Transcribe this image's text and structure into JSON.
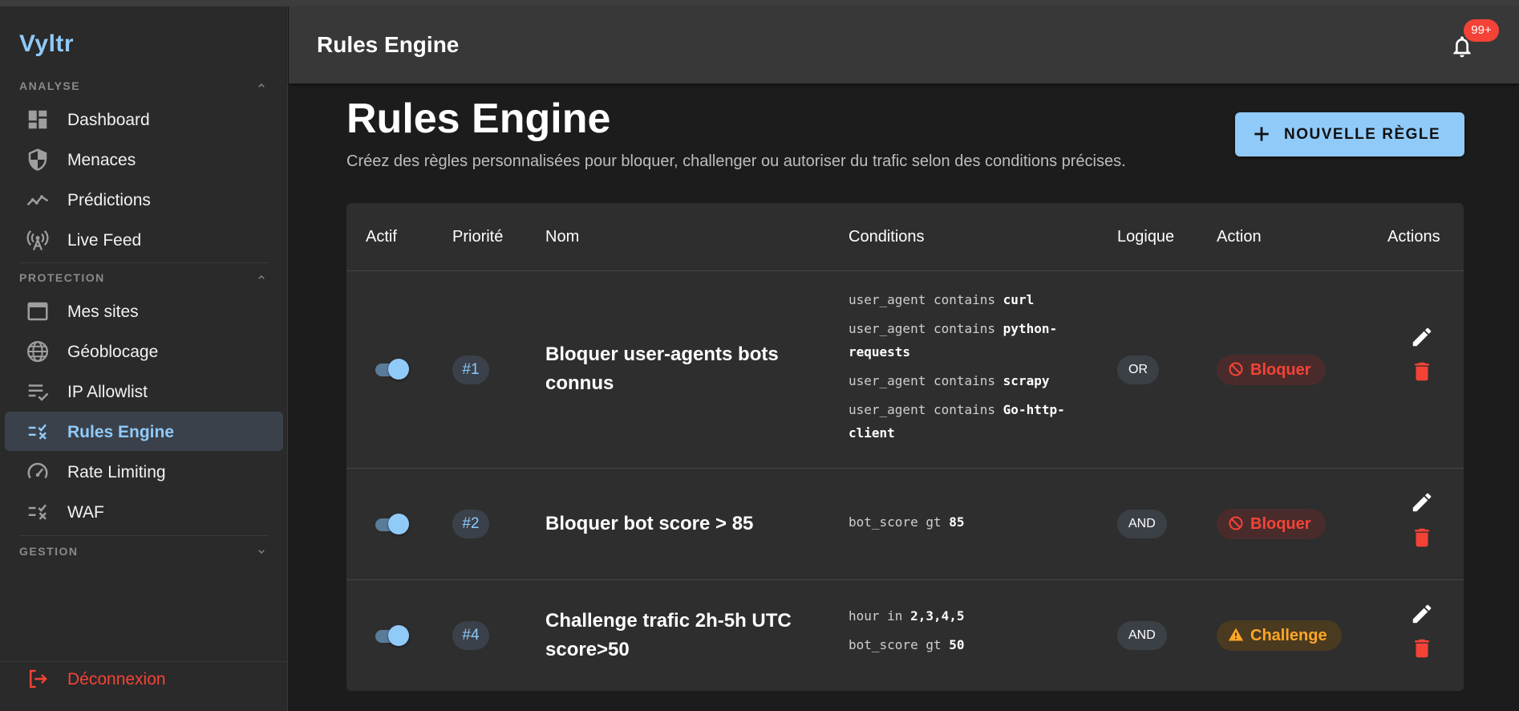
{
  "app": {
    "brand": "Vyltr"
  },
  "sidebar": {
    "sections": [
      {
        "title": "ANALYSE",
        "items": [
          {
            "label": "Dashboard",
            "icon": "dashboard-icon"
          },
          {
            "label": "Menaces",
            "icon": "shield-icon"
          },
          {
            "label": "Prédictions",
            "icon": "trend-icon"
          },
          {
            "label": "Live Feed",
            "icon": "broadcast-icon"
          }
        ]
      },
      {
        "title": "PROTECTION",
        "items": [
          {
            "label": "Mes sites",
            "icon": "window-icon"
          },
          {
            "label": "Géoblocage",
            "icon": "globe-icon"
          },
          {
            "label": "IP Allowlist",
            "icon": "checklist-icon"
          },
          {
            "label": "Rules Engine",
            "icon": "rules-icon",
            "active": true
          },
          {
            "label": "Rate Limiting",
            "icon": "speedometer-icon"
          },
          {
            "label": "WAF",
            "icon": "rules-icon"
          }
        ]
      },
      {
        "title": "GESTION",
        "items": []
      }
    ],
    "logout_label": "Déconnexion"
  },
  "header": {
    "title": "Rules Engine",
    "notifications": "99+"
  },
  "main": {
    "title": "Rules Engine",
    "subtitle": "Créez des règles personnalisées pour bloquer, challenger ou autoriser du trafic selon des conditions précises.",
    "new_button": "NOUVELLE RÈGLE"
  },
  "table": {
    "columns": [
      "Actif",
      "Priorité",
      "Nom",
      "Conditions",
      "Logique",
      "Action",
      "Actions"
    ],
    "rows": [
      {
        "active": true,
        "priority": "#1",
        "name": "Bloquer user-agents bots connus",
        "conditions": [
          {
            "field": "user_agent",
            "op": "contains",
            "value": "curl"
          },
          {
            "field": "user_agent",
            "op": "contains",
            "value": "python-requests"
          },
          {
            "field": "user_agent",
            "op": "contains",
            "value": "scrapy"
          },
          {
            "field": "user_agent",
            "op": "contains",
            "value": "Go-http-client"
          }
        ],
        "logic": "OR",
        "action": "Bloquer"
      },
      {
        "active": true,
        "priority": "#2",
        "name": "Bloquer bot score > 85",
        "conditions": [
          {
            "field": "bot_score",
            "op": "gt",
            "value": "85"
          }
        ],
        "logic": "AND",
        "action": "Bloquer"
      },
      {
        "active": true,
        "priority": "#4",
        "name": "Challenge trafic 2h-5h UTC score>50",
        "conditions": [
          {
            "field": "hour",
            "op": "in",
            "value": "2,3,4,5"
          },
          {
            "field": "bot_score",
            "op": "gt",
            "value": "50"
          }
        ],
        "logic": "AND",
        "action": "Challenge"
      }
    ]
  },
  "colors": {
    "accent": "#90caf9",
    "danger": "#f44336",
    "warning": "#ffa726"
  }
}
